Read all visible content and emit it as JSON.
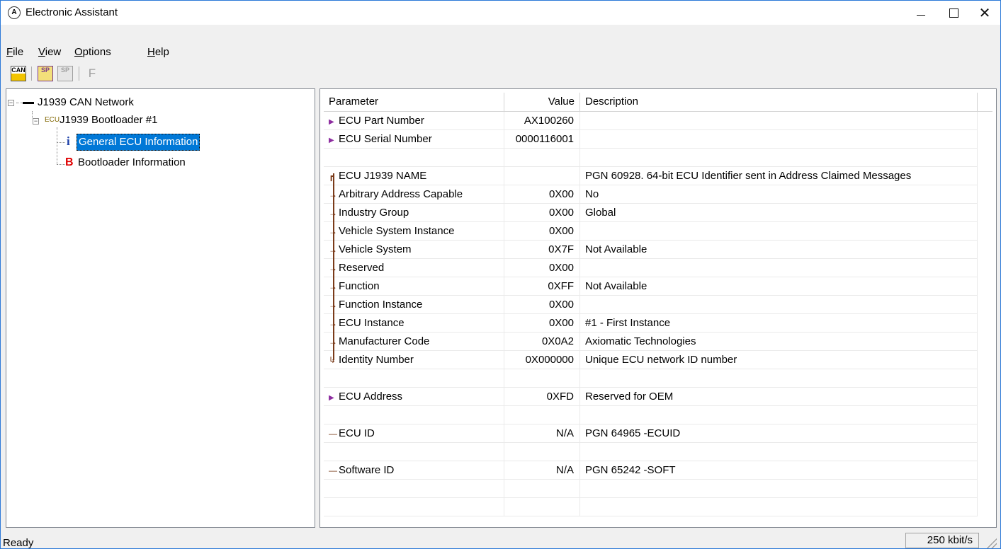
{
  "window": {
    "title": "Electronic Assistant",
    "close_glyph": "✕"
  },
  "menu": [
    {
      "key": "F",
      "rest": "ile"
    },
    {
      "key": "V",
      "rest": "iew"
    },
    {
      "key": "O",
      "rest": "ptions"
    },
    {
      "key": "H",
      "rest": "elp"
    }
  ],
  "toolbar": {
    "can_label": "CAN",
    "sp_label": "SP",
    "sp2_label": "SP",
    "f_label": "F"
  },
  "tree": {
    "network": {
      "label": "J1939 CAN Network",
      "expander": "−"
    },
    "bootloader": {
      "prefix": "ECU",
      "label": "J1939 Bootloader #1",
      "expander": "−"
    },
    "general": {
      "glyph": "i",
      "label": "General ECU Information"
    },
    "bootinfo": {
      "glyph": "B",
      "label": "Bootloader Information"
    }
  },
  "grid": {
    "headers": {
      "parameter": "Parameter",
      "value": "Value",
      "description": "Description"
    },
    "rows": [
      {
        "marker": "▶",
        "param": "ECU Part Number",
        "value": "AX100260",
        "desc": ""
      },
      {
        "marker": "▶",
        "param": "ECU Serial Number",
        "value": "0000116001",
        "desc": ""
      },
      {
        "marker": "",
        "param": "",
        "value": "",
        "desc": ""
      },
      {
        "marker": "┏",
        "param": "ECU J1939 NAME",
        "value": "",
        "desc": "PGN 60928. 64-bit ECU Identifier sent in Address Claimed Messages"
      },
      {
        "marker": "→",
        "param": "Arbitrary Address Capable",
        "value": "0X00",
        "desc": "No"
      },
      {
        "marker": "→",
        "param": "Industry Group",
        "value": "0X00",
        "desc": "Global"
      },
      {
        "marker": "→",
        "param": "Vehicle System Instance",
        "value": "0X00",
        "desc": ""
      },
      {
        "marker": "→",
        "param": "Vehicle System",
        "value": "0X7F",
        "desc": "Not Available"
      },
      {
        "marker": "→",
        "param": "Reserved",
        "value": "0X00",
        "desc": ""
      },
      {
        "marker": "→",
        "param": "Function",
        "value": "0XFF",
        "desc": "Not Available"
      },
      {
        "marker": "→",
        "param": "Function Instance",
        "value": "0X00",
        "desc": ""
      },
      {
        "marker": "→",
        "param": "ECU Instance",
        "value": "0X00",
        "desc": "#1 - First Instance"
      },
      {
        "marker": "→",
        "param": "Manufacturer Code",
        "value": "0X0A2",
        "desc": "Axiomatic Technologies"
      },
      {
        "marker": "↳",
        "param": "Identity Number",
        "value": "0X000000",
        "desc": "Unique ECU network ID number"
      },
      {
        "marker": "",
        "param": "",
        "value": "",
        "desc": ""
      },
      {
        "marker": "▶",
        "param": "ECU Address",
        "value": "0XFD",
        "desc": "Reserved for OEM"
      },
      {
        "marker": "",
        "param": "",
        "value": "",
        "desc": ""
      },
      {
        "marker": "—",
        "param": "ECU ID",
        "value": "N/A",
        "desc": "PGN 64965   -ECUID"
      },
      {
        "marker": "",
        "param": "",
        "value": "",
        "desc": ""
      },
      {
        "marker": "—",
        "param": "Software ID",
        "value": "N/A",
        "desc": "PGN 65242   -SOFT"
      },
      {
        "marker": "",
        "param": "",
        "value": "",
        "desc": ""
      },
      {
        "marker": "",
        "param": "",
        "value": "",
        "desc": ""
      }
    ]
  },
  "status": {
    "text": "Ready",
    "bitrate": "250 kbit/s"
  }
}
